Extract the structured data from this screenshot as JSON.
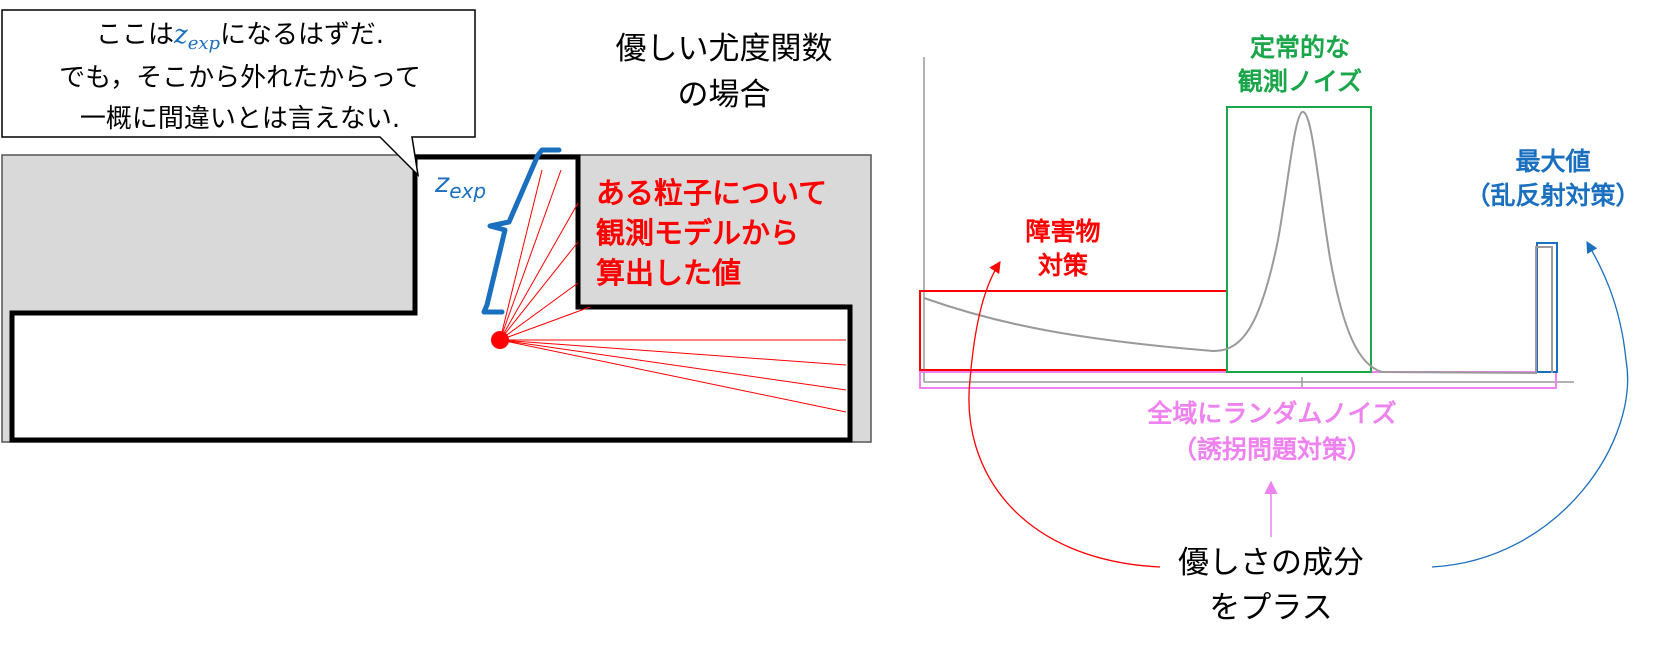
{
  "callout": {
    "line1_pre": "ここは",
    "line1_var": "z",
    "line1_sub": "exp",
    "line1_post": "になるはずだ.",
    "line2": "でも，そこから外れたからって",
    "line3": "一概に間違いとは言えない."
  },
  "title": {
    "line1": "優しい尤度関数",
    "line2": "の場合"
  },
  "zexp_label": {
    "var": "z",
    "sub": "exp"
  },
  "particle_note": {
    "line1": "ある粒子について",
    "line2": "観測モデルから",
    "line3": "算出した値"
  },
  "labels": {
    "noise": {
      "line1": "定常的な",
      "line2": "観測ノイズ"
    },
    "obstacle": {
      "line1": "障害物",
      "line2": "対策"
    },
    "maxval": {
      "line1": "最大値",
      "line2": "（乱反射対策）"
    },
    "random": {
      "line1": "全域にランダムノイズ",
      "line2": "（誘拐問題対策）"
    },
    "kindness": {
      "line1": "優しさの成分",
      "line2": "をプラス"
    }
  },
  "colors": {
    "accent_blue": "#1a6fbf",
    "accent_red": "#ff0000",
    "noise_green": "#1aa64a",
    "random_pink": "#ee82ee",
    "map_gray": "#d9d9d9",
    "curve_gray": "#9a9a9a"
  }
}
